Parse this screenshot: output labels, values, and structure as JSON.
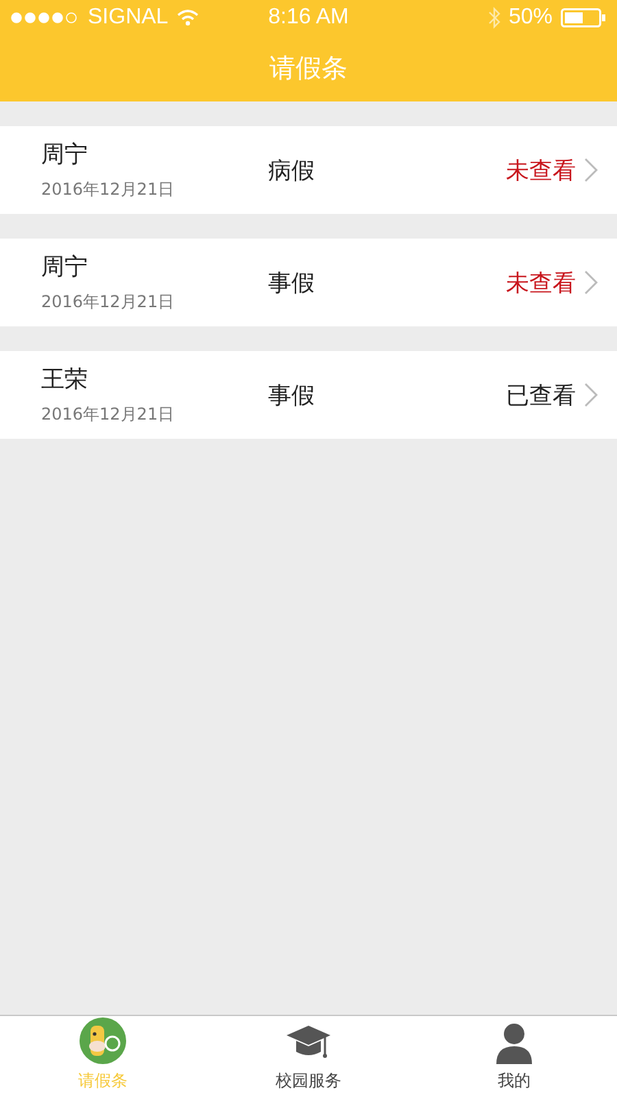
{
  "status_bar": {
    "carrier": "SIGNAL",
    "time": "8:16 AM",
    "battery": "50%"
  },
  "nav": {
    "title": "请假条"
  },
  "leave_list": [
    {
      "name": "周宁",
      "date": "2016年12月21日",
      "type": "病假",
      "status": "未查看",
      "viewed": false
    },
    {
      "name": "周宁",
      "date": "2016年12月21日",
      "type": "事假",
      "status": "未查看",
      "viewed": false
    },
    {
      "name": "王荣",
      "date": "2016年12月21日",
      "type": "事假",
      "status": "已查看",
      "viewed": true
    }
  ],
  "tab_bar": [
    {
      "kind": "leave",
      "label": "请假条",
      "selected": true
    },
    {
      "kind": "campus",
      "label": "校园服务",
      "selected": false
    },
    {
      "kind": "me",
      "label": "我的",
      "selected": false
    }
  ]
}
